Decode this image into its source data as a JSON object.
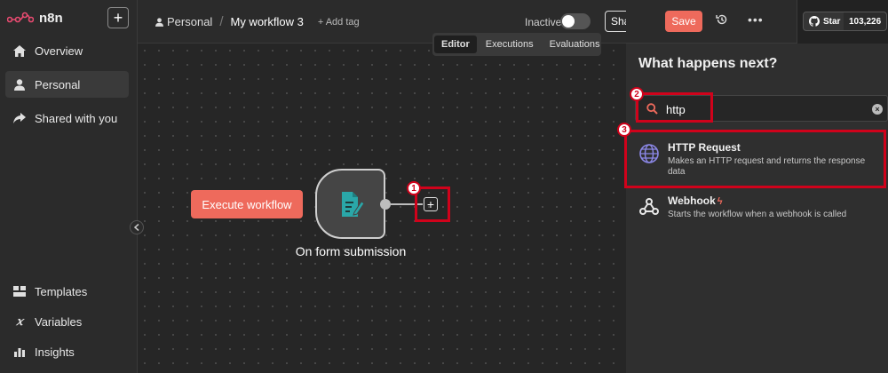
{
  "app": {
    "name": "n8n"
  },
  "sidebar": {
    "items": [
      {
        "label": "Overview",
        "icon": "home-icon"
      },
      {
        "label": "Personal",
        "icon": "user-icon",
        "active": true
      },
      {
        "label": "Shared with you",
        "icon": "share-icon"
      }
    ],
    "bottom_items": [
      {
        "label": "Templates",
        "icon": "templates-icon"
      },
      {
        "label": "Variables",
        "icon": "variables-icon"
      },
      {
        "label": "Insights",
        "icon": "insights-icon"
      }
    ]
  },
  "header": {
    "breadcrumb_project": "Personal",
    "breadcrumb_sep": "/",
    "workflow_name": "My workflow 3",
    "add_tag": "+ Add tag",
    "status_label": "Inactive",
    "share_label": "Share",
    "save_label": "Save",
    "more_label": "•••",
    "github_star_label": "Star",
    "github_star_count": "103,226"
  },
  "canvas": {
    "tabs": [
      {
        "label": "Editor",
        "active": true
      },
      {
        "label": "Executions"
      },
      {
        "label": "Evaluations"
      }
    ],
    "execute_label": "Execute workflow",
    "node": {
      "label": "On form submission",
      "icon": "form-icon"
    }
  },
  "panel": {
    "title": "What happens next?",
    "search": {
      "value": "http",
      "placeholder": ""
    },
    "results": [
      {
        "name": "HTTP Request",
        "description": "Makes an HTTP request and returns the response data",
        "icon": "globe-icon"
      },
      {
        "name": "Webhook",
        "description": "Starts the workflow when a webhook is called",
        "icon": "webhook-icon"
      }
    ]
  },
  "annotations": [
    {
      "label": "1"
    },
    {
      "label": "2"
    },
    {
      "label": "3"
    }
  ],
  "colors": {
    "accent": "#ee6a5c",
    "highlight": "#d0021b",
    "node_icon": "#2aa7a8"
  }
}
